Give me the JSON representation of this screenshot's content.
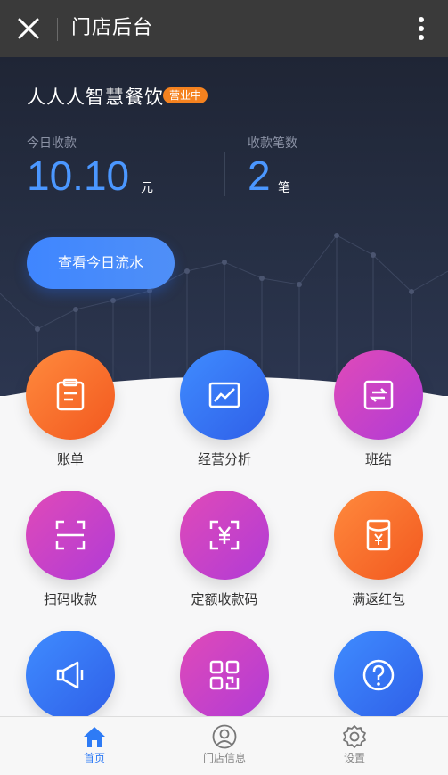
{
  "topbar": {
    "title": "门店后台",
    "close_icon": "close-icon",
    "more_icon": "more-vertical-icon"
  },
  "store": {
    "name": "人人人智慧餐饮",
    "status_badge": "营业中"
  },
  "stats": {
    "today_income_label": "今日收款",
    "today_income_value": "10.10",
    "today_income_unit": "元",
    "count_label": "收款笔数",
    "count_value": "2",
    "count_unit": "笔"
  },
  "flow_button": "查看今日流水",
  "menu": [
    {
      "label": "账单",
      "icon": "bill-icon",
      "color": "orange"
    },
    {
      "label": "经营分析",
      "icon": "chart-icon",
      "color": "blue"
    },
    {
      "label": "班结",
      "icon": "shift-settle-icon",
      "color": "magenta"
    },
    {
      "label": "扫码收款",
      "icon": "scan-icon",
      "color": "magenta"
    },
    {
      "label": "定额收款码",
      "icon": "yen-scan-icon",
      "color": "magenta"
    },
    {
      "label": "满返红包",
      "icon": "red-packet-icon",
      "color": "orange"
    },
    {
      "label": "",
      "icon": "megaphone-icon",
      "color": "blue"
    },
    {
      "label": "",
      "icon": "qrcode-icon",
      "color": "magenta"
    },
    {
      "label": "",
      "icon": "help-icon",
      "color": "blue"
    }
  ],
  "tabs": [
    {
      "label": "首页",
      "icon": "home-icon",
      "active": true
    },
    {
      "label": "门店信息",
      "icon": "user-icon",
      "active": false
    },
    {
      "label": "设置",
      "icon": "settings-icon",
      "active": false
    }
  ],
  "colors": {
    "accent": "#2e7bf5",
    "badge": "#f5821f",
    "hero_bg": "#232a3c"
  }
}
